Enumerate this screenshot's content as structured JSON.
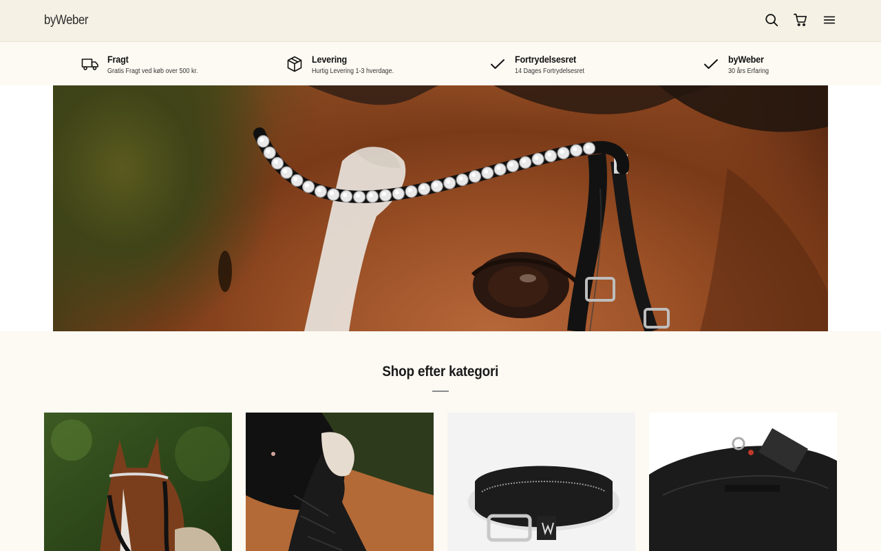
{
  "header": {
    "logo": "byWeber",
    "icons": [
      "search-icon",
      "cart-icon",
      "menu-icon"
    ]
  },
  "usp": [
    {
      "icon": "truck-icon",
      "title": "Fragt",
      "subtitle": "Gratis Fragt ved køb over 500 kr."
    },
    {
      "icon": "package-icon",
      "title": "Levering",
      "subtitle": "Hurtig Levering 1-3 hverdage."
    },
    {
      "icon": "check-icon",
      "title": "Fortrydelsesret",
      "subtitle": "14 Dages Fortrydelsesret"
    },
    {
      "icon": "check-icon",
      "title": "byWeber",
      "subtitle": "30 års Erfaring"
    }
  ],
  "categories": {
    "title": "Shop efter kategori",
    "items": [
      {
        "image": "horse-with-browband"
      },
      {
        "image": "saddle-pad"
      },
      {
        "image": "belt"
      },
      {
        "image": "girth"
      }
    ]
  },
  "colors": {
    "header_bg": "#f5f1e4",
    "page_bg": "#fdfaf3",
    "text": "#111111"
  }
}
